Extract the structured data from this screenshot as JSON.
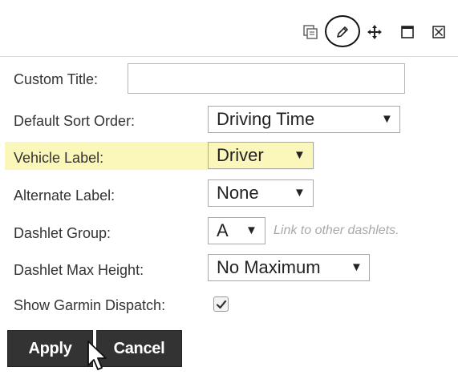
{
  "header": {
    "icons": [
      "copy-icon",
      "edit-pencil-icon",
      "move-icon",
      "maximize-icon",
      "close-box-icon"
    ]
  },
  "form": {
    "custom_title": {
      "label": "Custom Title:",
      "value": "",
      "placeholder": ""
    },
    "default_sort_order": {
      "label": "Default Sort Order:",
      "value": "Driving Time"
    },
    "vehicle_label": {
      "label": "Vehicle Label:",
      "value": "Driver",
      "highlight_color": "#fbf7ba"
    },
    "alternate_label": {
      "label": "Alternate Label:",
      "value": "None"
    },
    "dashlet_group": {
      "label": "Dashlet Group:",
      "value": "A",
      "hint": "Link to other dashlets."
    },
    "dashlet_max_height": {
      "label": "Dashlet Max Height:",
      "value": "No Maximum"
    },
    "show_garmin_dispatch": {
      "label": "Show Garmin Dispatch:",
      "checked": true
    }
  },
  "dropdown_arrow": "▼",
  "buttons": {
    "apply_label": "Apply",
    "cancel_label": "Cancel",
    "color": "#333333"
  }
}
